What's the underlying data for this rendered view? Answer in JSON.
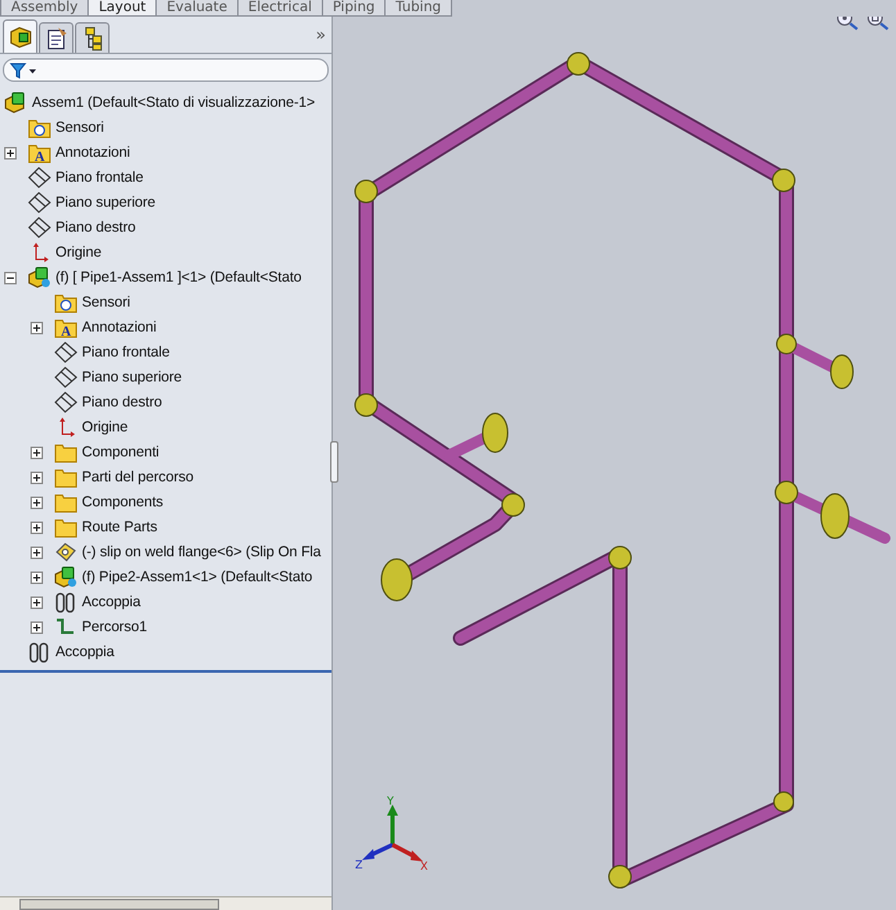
{
  "command_tabs": [
    {
      "label": "Assembly",
      "selected": false
    },
    {
      "label": "Layout",
      "selected": true
    },
    {
      "label": "Evaluate",
      "selected": false
    },
    {
      "label": "Electrical",
      "selected": false
    },
    {
      "label": "Piping",
      "selected": false
    },
    {
      "label": "Tubing",
      "selected": false
    }
  ],
  "panel_tabs": [
    {
      "kind": "tree",
      "selected": true
    },
    {
      "kind": "property",
      "selected": false
    },
    {
      "kind": "config",
      "selected": false
    }
  ],
  "panel_more": "»",
  "tree": [
    {
      "label": "Assem1  (Default<Stato di visualizzazione-1>",
      "kind": "assembly",
      "children": [
        {
          "label": "Sensori",
          "kind": "sensor"
        },
        {
          "label": "Annotazioni",
          "kind": "annotation",
          "icon_text": "A",
          "expanded": false
        },
        {
          "label": "Piano frontale",
          "kind": "plane"
        },
        {
          "label": "Piano superiore",
          "kind": "plane"
        },
        {
          "label": "Piano destro",
          "kind": "plane"
        },
        {
          "label": "Origine",
          "kind": "origin"
        },
        {
          "label": "(f) [ Pipe1-Assem1 ]<1> (Default<Stato",
          "kind": "subassembly",
          "expanded": true,
          "children": [
            {
              "label": "Sensori",
              "kind": "sensor"
            },
            {
              "label": "Annotazioni",
              "kind": "annotation",
              "icon_text": "A",
              "expanded": false
            },
            {
              "label": "Piano frontale",
              "kind": "plane"
            },
            {
              "label": "Piano superiore",
              "kind": "plane"
            },
            {
              "label": "Piano destro",
              "kind": "plane"
            },
            {
              "label": "Origine",
              "kind": "origin"
            },
            {
              "label": "Componenti",
              "kind": "folder",
              "expanded": false
            },
            {
              "label": "Parti del percorso",
              "kind": "folder",
              "expanded": false
            },
            {
              "label": "Components",
              "kind": "folder",
              "expanded": false
            },
            {
              "label": "Route Parts",
              "kind": "folder",
              "expanded": false
            },
            {
              "label": "(-) slip on weld flange<6> (Slip On Fla",
              "kind": "part",
              "expanded": false
            },
            {
              "label": "(f) Pipe2-Assem1<1> (Default<Stato",
              "kind": "subassembly",
              "expanded": false
            },
            {
              "label": "Accoppia",
              "kind": "mate",
              "expanded": false
            },
            {
              "label": "Percorso1",
              "kind": "route",
              "expanded": false
            }
          ]
        },
        {
          "label": "Accoppia",
          "kind": "mate"
        }
      ]
    }
  ],
  "axes": [
    {
      "label": "Y"
    },
    {
      "label": "Z"
    },
    {
      "label": "X"
    }
  ]
}
